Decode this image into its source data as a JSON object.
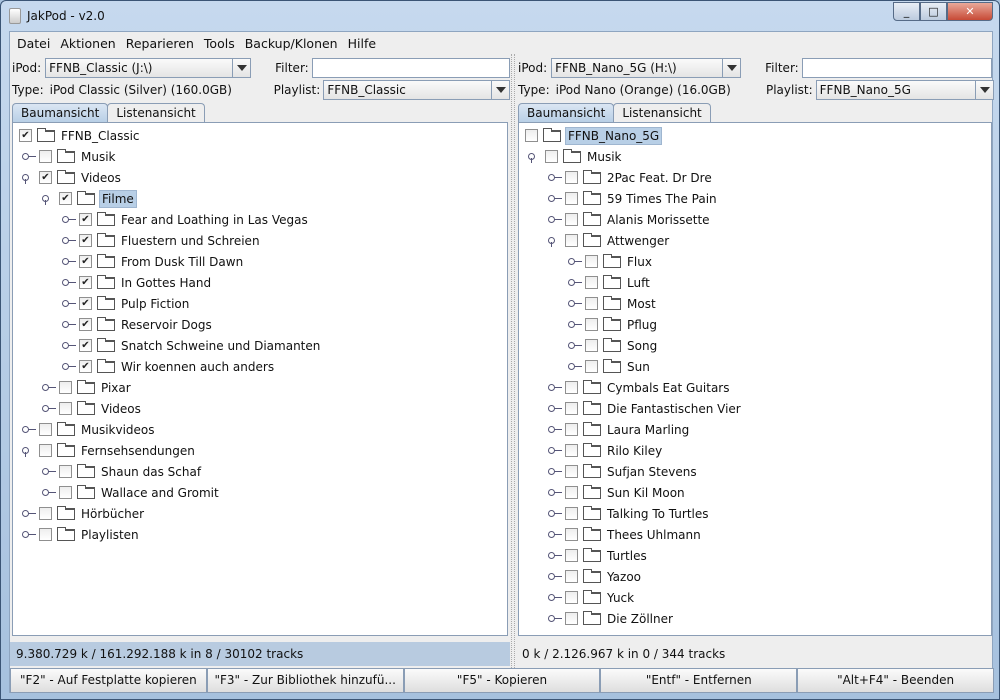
{
  "window": {
    "title": "JakPod - v2.0",
    "minimize": "_",
    "maximize": "□",
    "close": "✕"
  },
  "menu": [
    "Datei",
    "Aktionen",
    "Reparieren",
    "Tools",
    "Backup/Klonen",
    "Hilfe"
  ],
  "left": {
    "ipod_label": "iPod:",
    "ipod_value": "FFNB_Classic (J:\\)",
    "filter_label": "Filter:",
    "filter_value": "",
    "type_label": "Type:",
    "type_value": "iPod Classic (Silver) (160.0GB)",
    "playlist_label": "Playlist:",
    "playlist_value": "FFNB_Classic",
    "tabs": [
      "Baumansicht",
      "Listenansicht"
    ],
    "status": "9.380.729 k /   161.292.188 k in   8 /   30102 tracks",
    "tree": [
      {
        "name": "FFNB_Classic",
        "level": 0,
        "checked": true,
        "exp": ""
      },
      {
        "name": "Musik",
        "level": 1,
        "checked": false,
        "exp": "closed"
      },
      {
        "name": "Videos",
        "level": 1,
        "checked": true,
        "exp": "open"
      },
      {
        "name": "Filme",
        "level": 2,
        "checked": true,
        "exp": "open",
        "selected": true
      },
      {
        "name": "Fear and Loathing in Las Vegas",
        "level": 3,
        "checked": true,
        "exp": "closed"
      },
      {
        "name": "Fluestern und Schreien",
        "level": 3,
        "checked": true,
        "exp": "closed"
      },
      {
        "name": "From Dusk Till Dawn",
        "level": 3,
        "checked": true,
        "exp": "closed"
      },
      {
        "name": "In Gottes Hand",
        "level": 3,
        "checked": true,
        "exp": "closed"
      },
      {
        "name": "Pulp Fiction",
        "level": 3,
        "checked": true,
        "exp": "closed"
      },
      {
        "name": "Reservoir Dogs",
        "level": 3,
        "checked": true,
        "exp": "closed"
      },
      {
        "name": "Snatch Schweine und Diamanten",
        "level": 3,
        "checked": true,
        "exp": "closed"
      },
      {
        "name": "Wir koennen auch anders",
        "level": 3,
        "checked": true,
        "exp": "closed"
      },
      {
        "name": "Pixar",
        "level": 2,
        "checked": false,
        "exp": "closed"
      },
      {
        "name": "Videos",
        "level": 2,
        "checked": false,
        "exp": "closed"
      },
      {
        "name": "Musikvideos",
        "level": 1,
        "checked": false,
        "exp": "closed"
      },
      {
        "name": "Fernsehsendungen",
        "level": 1,
        "checked": false,
        "exp": "open"
      },
      {
        "name": "Shaun das Schaf",
        "level": 2,
        "checked": false,
        "exp": "closed"
      },
      {
        "name": "Wallace and Gromit",
        "level": 2,
        "checked": false,
        "exp": "closed"
      },
      {
        "name": "Hörbücher",
        "level": 1,
        "checked": false,
        "exp": "closed"
      },
      {
        "name": "Playlisten",
        "level": 1,
        "checked": false,
        "exp": "closed"
      }
    ]
  },
  "right": {
    "ipod_label": "iPod:",
    "ipod_value": "FFNB_Nano_5G (H:\\)",
    "filter_label": "Filter:",
    "filter_value": "",
    "type_label": "Type:",
    "type_value": "iPod Nano (Orange) (16.0GB)",
    "playlist_label": "Playlist:",
    "playlist_value": "FFNB_Nano_5G",
    "tabs": [
      "Baumansicht",
      "Listenansicht"
    ],
    "status": "0 k /   2.126.967 k in   0 /   344 tracks",
    "tree": [
      {
        "name": "FFNB_Nano_5G",
        "level": 0,
        "checked": false,
        "exp": "",
        "selected": true
      },
      {
        "name": "Musik",
        "level": 1,
        "checked": false,
        "exp": "open"
      },
      {
        "name": "2Pac Feat. Dr Dre",
        "level": 2,
        "checked": false,
        "exp": "closed"
      },
      {
        "name": "59 Times The Pain",
        "level": 2,
        "checked": false,
        "exp": "closed"
      },
      {
        "name": "Alanis Morissette",
        "level": 2,
        "checked": false,
        "exp": "closed"
      },
      {
        "name": "Attwenger",
        "level": 2,
        "checked": false,
        "exp": "open"
      },
      {
        "name": "Flux",
        "level": 3,
        "checked": false,
        "exp": "closed"
      },
      {
        "name": "Luft",
        "level": 3,
        "checked": false,
        "exp": "closed"
      },
      {
        "name": "Most",
        "level": 3,
        "checked": false,
        "exp": "closed"
      },
      {
        "name": "Pflug",
        "level": 3,
        "checked": false,
        "exp": "closed"
      },
      {
        "name": "Song",
        "level": 3,
        "checked": false,
        "exp": "closed"
      },
      {
        "name": "Sun",
        "level": 3,
        "checked": false,
        "exp": "closed"
      },
      {
        "name": "Cymbals Eat Guitars",
        "level": 2,
        "checked": false,
        "exp": "closed"
      },
      {
        "name": "Die Fantastischen Vier",
        "level": 2,
        "checked": false,
        "exp": "closed"
      },
      {
        "name": "Laura Marling",
        "level": 2,
        "checked": false,
        "exp": "closed"
      },
      {
        "name": "Rilo Kiley",
        "level": 2,
        "checked": false,
        "exp": "closed"
      },
      {
        "name": "Sufjan Stevens",
        "level": 2,
        "checked": false,
        "exp": "closed"
      },
      {
        "name": "Sun Kil Moon",
        "level": 2,
        "checked": false,
        "exp": "closed"
      },
      {
        "name": "Talking To Turtles",
        "level": 2,
        "checked": false,
        "exp": "closed"
      },
      {
        "name": "Thees Uhlmann",
        "level": 2,
        "checked": false,
        "exp": "closed"
      },
      {
        "name": "Turtles",
        "level": 2,
        "checked": false,
        "exp": "closed"
      },
      {
        "name": "Yazoo",
        "level": 2,
        "checked": false,
        "exp": "closed"
      },
      {
        "name": "Yuck",
        "level": 2,
        "checked": false,
        "exp": "closed"
      },
      {
        "name": "Die Zöllner",
        "level": 2,
        "checked": false,
        "exp": "closed"
      }
    ]
  },
  "buttons": [
    "\"F2\" - Auf Festplatte kopieren",
    "\"F3\" - Zur Bibliothek hinzufü...",
    "\"F5\" - Kopieren",
    "\"Entf\" - Entfernen",
    "\"Alt+F4\" - Beenden"
  ]
}
